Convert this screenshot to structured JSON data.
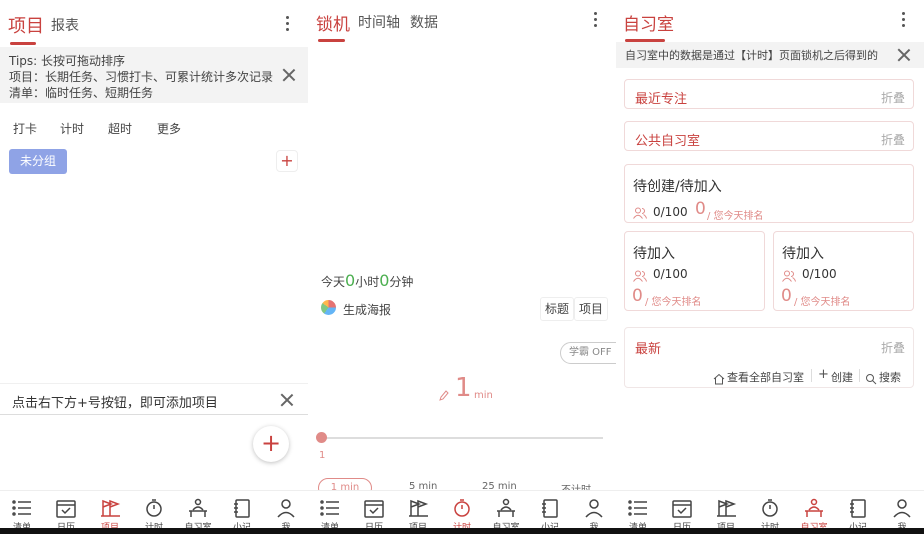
{
  "panel1": {
    "tabs": [
      "项目",
      "报表"
    ],
    "tips": {
      "line1": "Tips: 长按可拖动排序",
      "line2": "项目：长期任务、习惯打卡、可累计统计多次记录",
      "line3": "清单：临时任务、短期任务"
    },
    "filters": [
      "打卡",
      "计时",
      "超时",
      "更多"
    ],
    "group_button": "未分组",
    "hint": "点击右下方+号按钮，即可添加项目"
  },
  "panel2": {
    "tabs": [
      "锁机",
      "时间轴",
      "数据"
    ],
    "today_prefix": "今天",
    "today_hours": "0",
    "today_hours_unit": "小时",
    "today_minutes": "0",
    "today_minutes_unit": "分钟",
    "poster": "生成海报",
    "title_btn": "标题",
    "project_btn": "项目",
    "xueba": "学霸 OFF",
    "timer_value": "1",
    "timer_unit": "min",
    "slider_label": "1",
    "slider_value": 0,
    "presets": [
      "1 min",
      "5 min",
      "25 min",
      "不计时"
    ]
  },
  "panel3": {
    "title": "自习室",
    "notice": "自习室中的数据是通过【计时】页面锁机之后得到的",
    "recent": "最近专注",
    "public": "公共自习室",
    "fold": "折叠",
    "pending_create": {
      "title": "待创建/待加入",
      "count": "0/100",
      "rank_num": "0",
      "rank_text": "/ 您今天排名"
    },
    "pending_a": {
      "title": "待加入",
      "count": "0/100",
      "rank_num": "0",
      "rank_text": "/ 您今天排名"
    },
    "pending_b": {
      "title": "待加入",
      "count": "0/100",
      "rank_num": "0",
      "rank_text": "/ 您今天排名"
    },
    "latest": "最新",
    "view_all": "查看全部自习室",
    "create": "创建",
    "search": "搜索"
  },
  "nav": {
    "items": [
      "清单",
      "日历",
      "项目",
      "计时",
      "自习室",
      "小记",
      "我"
    ]
  },
  "colors": {
    "accent": "#c9423f",
    "group_btn": "#8fa3e6",
    "green": "#4caf50"
  }
}
